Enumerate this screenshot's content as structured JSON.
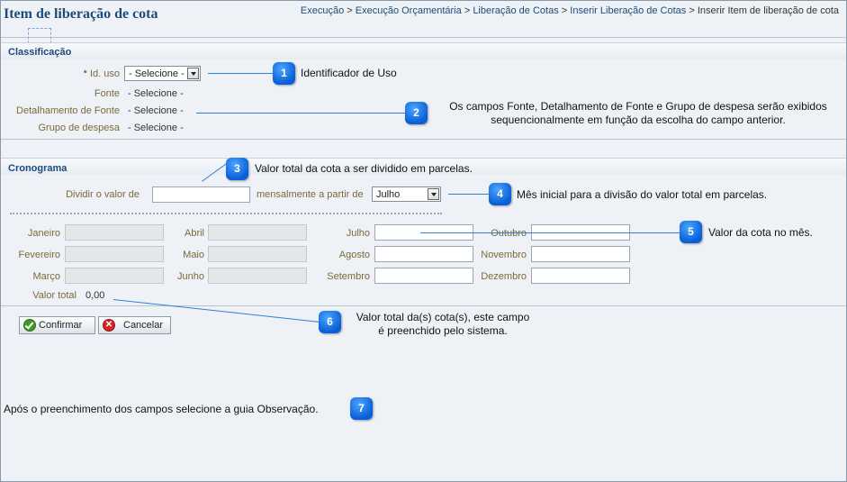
{
  "header": {
    "title": "Item de liberação de cota",
    "breadcrumb": [
      "Execução",
      "Execução Orçamentária",
      "Liberação de Cotas",
      "Inserir Liberação de Cotas",
      "Inserir Item de liberação de cota"
    ],
    "separator": ">"
  },
  "classificacao": {
    "title": "Classificação",
    "id_uso": {
      "required_mark": "*",
      "label": "Id. uso",
      "value": "- Selecione -"
    },
    "fonte": {
      "label": "Fonte",
      "value": "- Selecione -"
    },
    "detalhamento": {
      "label": "Detalhamento de Fonte",
      "value": "- Selecione -"
    },
    "grupo": {
      "label": "Grupo de despesa",
      "value": "- Selecione -"
    }
  },
  "cronograma": {
    "title": "Cronograma",
    "dividir_label": "Dividir o valor de",
    "dividir_value": "",
    "mensal_label": "mensalmente a partir de",
    "mes_inicial": "Julho",
    "months": [
      {
        "label": "Janeiro",
        "value": "",
        "disabled": true
      },
      {
        "label": "Fevereiro",
        "value": "",
        "disabled": true
      },
      {
        "label": "Março",
        "value": "",
        "disabled": true
      },
      {
        "label": "Abril",
        "value": "",
        "disabled": true
      },
      {
        "label": "Maio",
        "value": "",
        "disabled": true
      },
      {
        "label": "Junho",
        "value": "",
        "disabled": true
      },
      {
        "label": "Julho",
        "value": "",
        "disabled": false
      },
      {
        "label": "Agosto",
        "value": "",
        "disabled": false
      },
      {
        "label": "Setembro",
        "value": "",
        "disabled": false
      },
      {
        "label": "Outubro",
        "value": "",
        "disabled": false
      },
      {
        "label": "Novembro",
        "value": "",
        "disabled": false
      },
      {
        "label": "Dezembro",
        "value": "",
        "disabled": false
      }
    ],
    "total_label": "Valor total",
    "total_value": "0,00"
  },
  "buttons": {
    "confirm": "Confirmar",
    "cancel": "Cancelar",
    "cancel_icon_glyph": "✕"
  },
  "callouts": [
    {
      "n": "1",
      "lines": [
        "Identificador de Uso"
      ]
    },
    {
      "n": "2",
      "lines": [
        "Os campos Fonte, Detalhamento de Fonte e Grupo de despesa serão exibidos",
        "sequencionalmente em função da escolha do campo anterior."
      ]
    },
    {
      "n": "3",
      "lines": [
        "Valor total da cota a ser dividido em parcelas."
      ]
    },
    {
      "n": "4",
      "lines": [
        "Mês inicial para a divisão do valor total em parcelas."
      ]
    },
    {
      "n": "5",
      "lines": [
        "Valor da cota no mês."
      ]
    },
    {
      "n": "6",
      "lines": [
        "Valor total da(s) cota(s), este campo",
        "é preenchido pelo sistema."
      ]
    },
    {
      "n": "7",
      "lines": [
        "Após o preenchimento dos campos selecione a guia Observação."
      ]
    }
  ],
  "colors": {
    "accent": "#1d4a7a",
    "label": "#7a6a3a",
    "callout": "#0a5fd6",
    "background": "#eef2f6"
  }
}
